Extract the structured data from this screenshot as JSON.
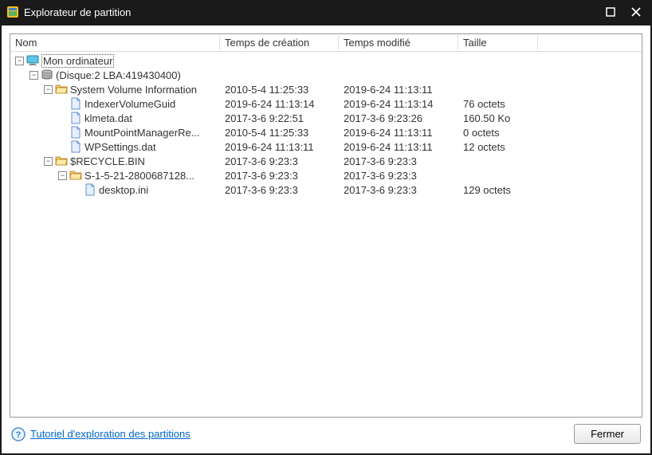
{
  "titlebar": {
    "title": "Explorateur de partition"
  },
  "columns": {
    "name": "Nom",
    "created": "Temps de création",
    "modified": "Temps modifié",
    "size": "Taille"
  },
  "tree": {
    "root": {
      "label": "Mon ordinateur",
      "expanded": true
    },
    "disk": {
      "label": "(Disque:2 LBA:419430400)",
      "expanded": true
    },
    "svi": {
      "label": "System Volume Information",
      "created": "2010-5-4 11:25:33",
      "modified": "2019-6-24 11:13:11",
      "size": "",
      "expanded": true
    },
    "svi_children": [
      {
        "label": "IndexerVolumeGuid",
        "created": "2019-6-24 11:13:14",
        "modified": "2019-6-24 11:13:14",
        "size": "76 octets"
      },
      {
        "label": "klmeta.dat",
        "created": "2017-3-6 9:22:51",
        "modified": "2017-3-6 9:23:26",
        "size": "160.50 Ko"
      },
      {
        "label": "MountPointManagerRe...",
        "created": "2010-5-4 11:25:33",
        "modified": "2019-6-24 11:13:11",
        "size": "0 octets"
      },
      {
        "label": "WPSettings.dat",
        "created": "2019-6-24 11:13:11",
        "modified": "2019-6-24 11:13:11",
        "size": "12 octets"
      }
    ],
    "recycle": {
      "label": "$RECYCLE.BIN",
      "created": "2017-3-6 9:23:3",
      "modified": "2017-3-6 9:23:3",
      "size": "",
      "expanded": true
    },
    "recycle_sub": {
      "label": "S-1-5-21-2800687128...",
      "created": "2017-3-6 9:23:3",
      "modified": "2017-3-6 9:23:3",
      "size": "",
      "expanded": true
    },
    "desktop_ini": {
      "label": "desktop.ini",
      "created": "2017-3-6 9:23:3",
      "modified": "2017-3-6 9:23:3",
      "size": "129 octets"
    }
  },
  "footer": {
    "tutorial_link": "Tutoriel d'exploration des partitions",
    "close_button": "Fermer"
  }
}
